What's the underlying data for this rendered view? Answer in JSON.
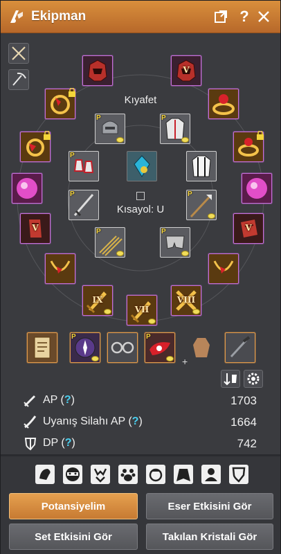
{
  "window": {
    "title": "Ekipman",
    "help_glyph": "?"
  },
  "colors": {
    "title_bar": "#c97a33",
    "accent_button": "#d48a3e",
    "rarity_purple": "#c46ed8",
    "rarity_orange": "#e19a4a",
    "help_marker": "#4ad0f0"
  },
  "labels": {
    "outfit": "Kıyafet",
    "shortcut": "Kısayol: U",
    "plus": "+"
  },
  "slots": {
    "weapon_enhancement": "IX",
    "armor_enhancement_vii": "VII",
    "armor_enhancement_viii": "VIII",
    "accessory_enhancement": "V",
    "locked_badge": "P"
  },
  "stats": [
    {
      "label": "AP",
      "help": "?",
      "value": "1703",
      "icon": "sword-icon"
    },
    {
      "label": "Uyanış Silahı AP",
      "help": "?",
      "value": "1664",
      "icon": "awakening-sword-icon"
    },
    {
      "label": "DP",
      "help": "?",
      "value": "742",
      "icon": "shield-icon"
    }
  ],
  "buttons": {
    "potential": "Potansiyelim",
    "artifact": "Eser Etkisini Gör",
    "set_effect": "Set Etkisini Gör",
    "crystals": "Takılan Kristali Gör"
  }
}
